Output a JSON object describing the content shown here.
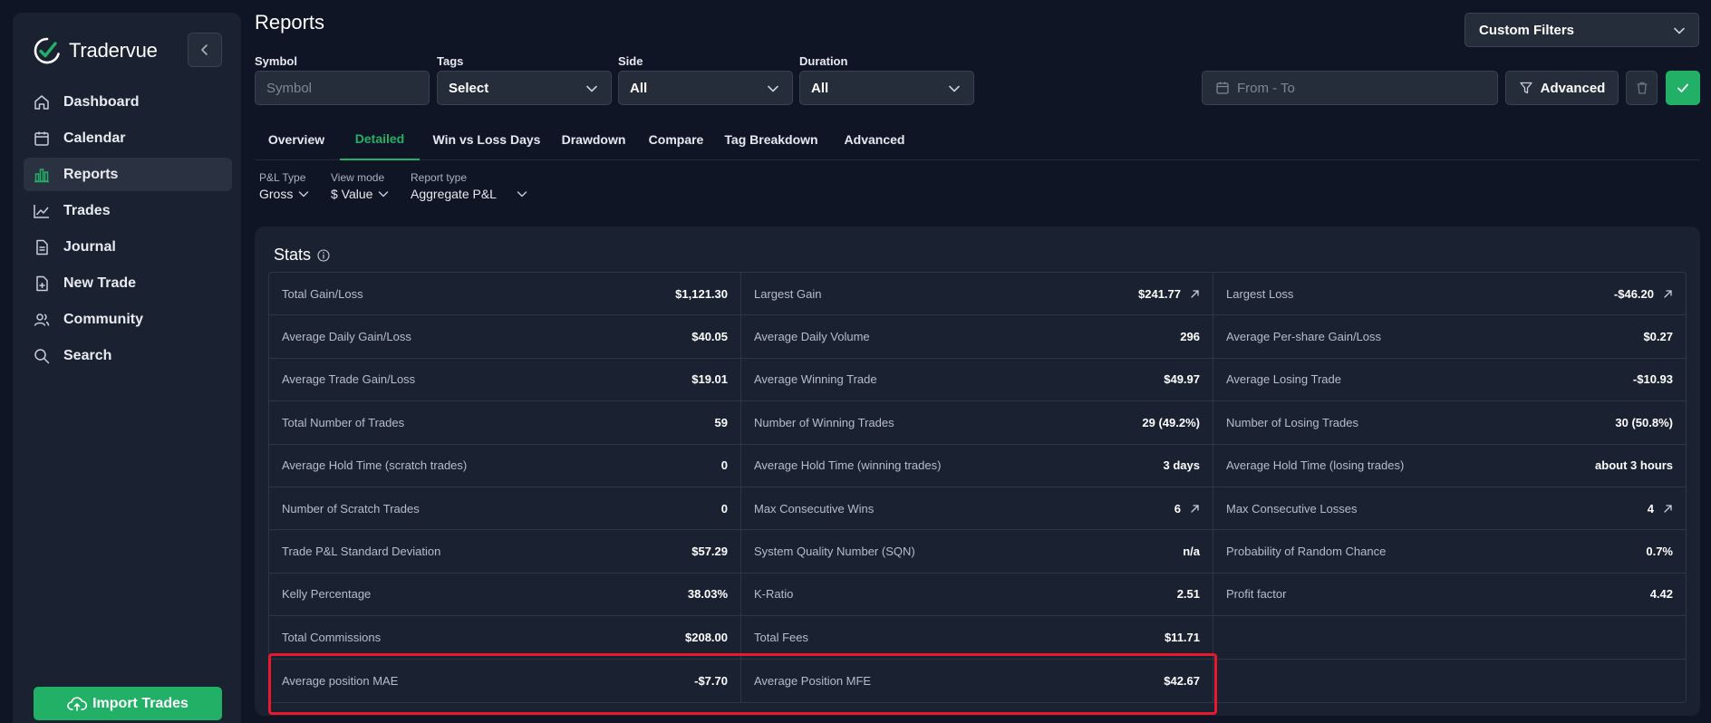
{
  "app": {
    "name": "Tradervue"
  },
  "sidebar": {
    "items": [
      {
        "label": "Dashboard",
        "icon": "home-icon"
      },
      {
        "label": "Calendar",
        "icon": "calendar-icon"
      },
      {
        "label": "Reports",
        "icon": "bar-chart-icon",
        "active": true
      },
      {
        "label": "Trades",
        "icon": "line-chart-icon"
      },
      {
        "label": "Journal",
        "icon": "document-icon"
      },
      {
        "label": "New Trade",
        "icon": "file-plus-icon"
      },
      {
        "label": "Community",
        "icon": "users-icon"
      },
      {
        "label": "Search",
        "icon": "search-icon"
      }
    ],
    "import_label": "Import Trades"
  },
  "header": {
    "title": "Reports",
    "custom_filters_label": "Custom Filters"
  },
  "filters": {
    "symbol": {
      "label": "Symbol",
      "placeholder": "Symbol"
    },
    "tags": {
      "label": "Tags",
      "value": "Select"
    },
    "side": {
      "label": "Side",
      "value": "All"
    },
    "duration": {
      "label": "Duration",
      "value": "All"
    },
    "date_range": {
      "placeholder": "From - To"
    },
    "advanced_label": "Advanced"
  },
  "tabs": [
    {
      "label": "Overview"
    },
    {
      "label": "Detailed",
      "active": true
    },
    {
      "label": "Win vs Loss Days"
    },
    {
      "label": "Drawdown"
    },
    {
      "label": "Compare"
    },
    {
      "label": "Tag Breakdown"
    },
    {
      "label": "Advanced"
    }
  ],
  "options": {
    "pnl_type": {
      "label": "P&L Type",
      "value": "Gross"
    },
    "view_mode": {
      "label": "View mode",
      "value": "$ Value"
    },
    "report_type": {
      "label": "Report type",
      "value": "Aggregate P&L"
    }
  },
  "stats": {
    "title": "Stats",
    "rows": [
      [
        {
          "label": "Total Gain/Loss",
          "value": "$1,121.30"
        },
        {
          "label": "Largest Gain",
          "value": "$241.77",
          "link": true
        },
        {
          "label": "Largest Loss",
          "value": "-$46.20",
          "link": true
        }
      ],
      [
        {
          "label": "Average Daily Gain/Loss",
          "value": "$40.05"
        },
        {
          "label": "Average Daily Volume",
          "value": "296"
        },
        {
          "label": "Average Per-share Gain/Loss",
          "value": "$0.27"
        }
      ],
      [
        {
          "label": "Average Trade Gain/Loss",
          "value": "$19.01"
        },
        {
          "label": "Average Winning Trade",
          "value": "$49.97"
        },
        {
          "label": "Average Losing Trade",
          "value": "-$10.93"
        }
      ],
      [
        {
          "label": "Total Number of Trades",
          "value": "59"
        },
        {
          "label": "Number of Winning Trades",
          "value": "29 (49.2%)"
        },
        {
          "label": "Number of Losing Trades",
          "value": "30 (50.8%)"
        }
      ],
      [
        {
          "label": "Average Hold Time (scratch trades)",
          "value": "0"
        },
        {
          "label": "Average Hold Time (winning trades)",
          "value": "3 days"
        },
        {
          "label": "Average Hold Time (losing trades)",
          "value": "about 3 hours"
        }
      ],
      [
        {
          "label": "Number of Scratch Trades",
          "value": "0"
        },
        {
          "label": "Max Consecutive Wins",
          "value": "6",
          "link": true
        },
        {
          "label": "Max Consecutive Losses",
          "value": "4",
          "link": true
        }
      ],
      [
        {
          "label": "Trade P&L Standard Deviation",
          "value": "$57.29"
        },
        {
          "label": "System Quality Number (SQN)",
          "value": "n/a"
        },
        {
          "label": "Probability of Random Chance",
          "value": "0.7%"
        }
      ],
      [
        {
          "label": "Kelly Percentage",
          "value": "38.03%"
        },
        {
          "label": "K-Ratio",
          "value": "2.51"
        },
        {
          "label": "Profit factor",
          "value": "4.42"
        }
      ],
      [
        {
          "label": "Total Commissions",
          "value": "$208.00"
        },
        {
          "label": "Total Fees",
          "value": "$11.71"
        },
        {
          "label": "",
          "value": ""
        }
      ],
      [
        {
          "label": "Average position MAE",
          "value": "-$7.70"
        },
        {
          "label": "Average Position MFE",
          "value": "$42.67"
        },
        {
          "label": "",
          "value": ""
        }
      ]
    ]
  },
  "colors": {
    "accent": "#22b067",
    "highlight": "#e8192c",
    "background": "#0f1524",
    "panel": "#1a2130"
  }
}
